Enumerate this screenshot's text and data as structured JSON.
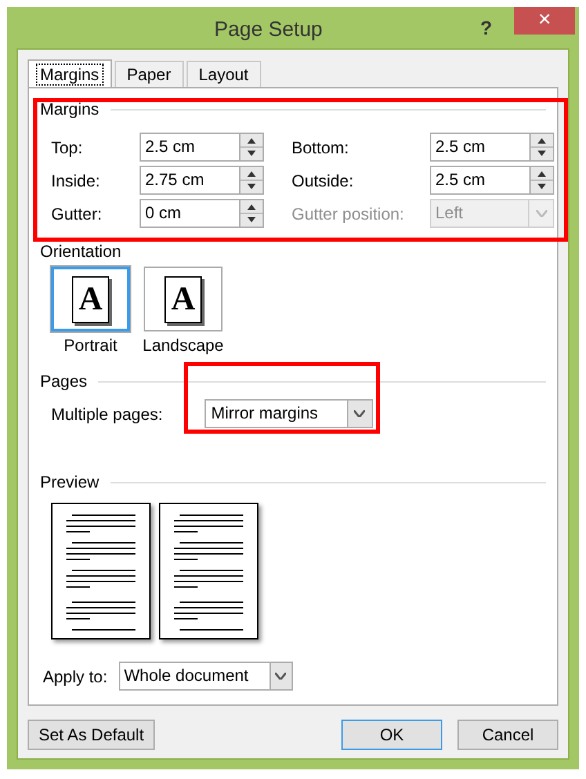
{
  "window": {
    "title": "Page Setup",
    "help": "?",
    "close": "×"
  },
  "tabs": [
    {
      "label": "Margins",
      "selected": true
    },
    {
      "label": "Paper",
      "selected": false
    },
    {
      "label": "Layout",
      "selected": false
    }
  ],
  "margins": {
    "heading": "Margins",
    "highlighted": true,
    "fields": [
      {
        "label": "Top:",
        "value": "2.5 cm",
        "kind": "spin",
        "disabled": false
      },
      {
        "label": "Bottom:",
        "value": "2.5 cm",
        "kind": "spin",
        "disabled": false
      },
      {
        "label": "Inside:",
        "value": "2.75 cm",
        "kind": "spin",
        "disabled": false
      },
      {
        "label": "Outside:",
        "value": "2.5 cm",
        "kind": "spin",
        "disabled": false
      },
      {
        "label": "Gutter:",
        "value": "0 cm",
        "kind": "spin",
        "disabled": false
      },
      {
        "label": "Gutter position:",
        "value": "Left",
        "kind": "combo",
        "disabled": true
      }
    ]
  },
  "orientation": {
    "heading": "Orientation",
    "options": [
      {
        "label": "Portrait",
        "glyph": "A",
        "selected": true
      },
      {
        "label": "Landscape",
        "glyph": "A",
        "selected": false
      }
    ]
  },
  "pages": {
    "heading": "Pages",
    "label": "Multiple pages:",
    "value": "Mirror margins",
    "highlighted": true
  },
  "preview": {
    "heading": "Preview"
  },
  "apply_to": {
    "label": "Apply to:",
    "value": "Whole document"
  },
  "buttons": [
    {
      "label": "Set As Default",
      "default": false
    },
    {
      "label": "OK",
      "default": true
    },
    {
      "label": "Cancel",
      "default": false
    }
  ]
}
